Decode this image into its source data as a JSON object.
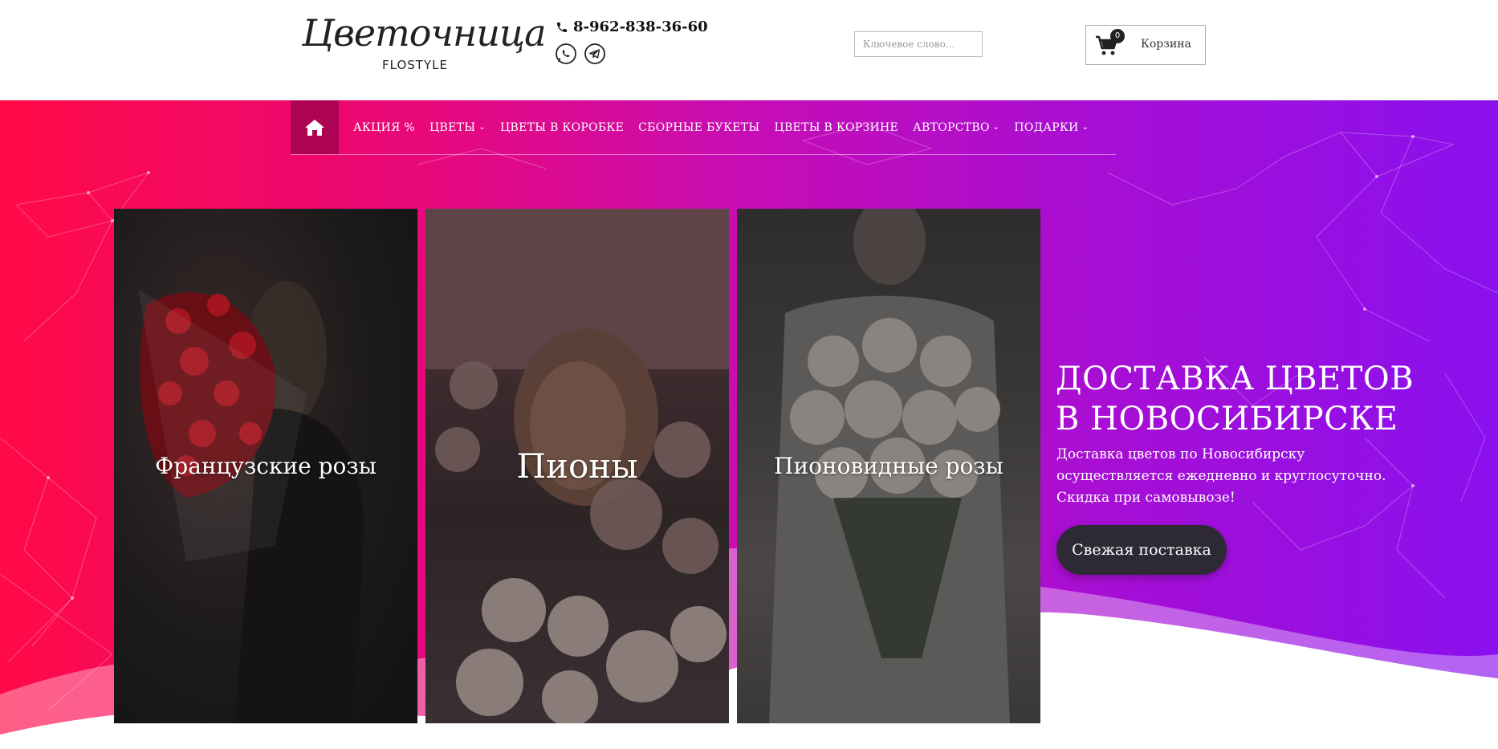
{
  "header": {
    "logo_script": "Цветочница",
    "logo_sub": "FLOSTYLE",
    "phone": "8-962-838-36-60",
    "search_placeholder": "Ключевое слово...",
    "cart_count": "0",
    "cart_label": "Корзина"
  },
  "nav": {
    "items": [
      {
        "label": "АКЦИЯ %",
        "dropdown": false
      },
      {
        "label": "ЦВЕТЫ",
        "dropdown": true
      },
      {
        "label": "ЦВЕТЫ В КОРОБКЕ",
        "dropdown": false
      },
      {
        "label": "СБОРНЫЕ БУКЕТЫ",
        "dropdown": false
      },
      {
        "label": "ЦВЕТЫ В КОРЗИНЕ",
        "dropdown": false
      },
      {
        "label": "АВТОРСТВО",
        "dropdown": true
      },
      {
        "label": "ПОДАРКИ",
        "dropdown": true
      }
    ]
  },
  "cards": [
    {
      "title": "Французские розы"
    },
    {
      "title": "Пионы"
    },
    {
      "title": "Пионовидные розы"
    }
  ],
  "promo": {
    "title_line1": "ДОСТАВКА ЦВЕТОВ",
    "title_line2": "В НОВОСИБИРСКЕ",
    "text_line1": "Доставка цветов по Новосибирску",
    "text_line2": "осуществляется ежедневно и круглосуточно.",
    "text_line3": "Скидка при самовывозе!",
    "button": "Свежая поставка"
  },
  "colors": {
    "gradient_start": "#ff0a47",
    "gradient_end": "#8a10ee",
    "button_bg": "#2d2a35"
  },
  "icons": [
    "home-icon",
    "phone-icon",
    "whatsapp-icon",
    "telegram-icon",
    "cart-icon",
    "chevron-down-icon"
  ]
}
